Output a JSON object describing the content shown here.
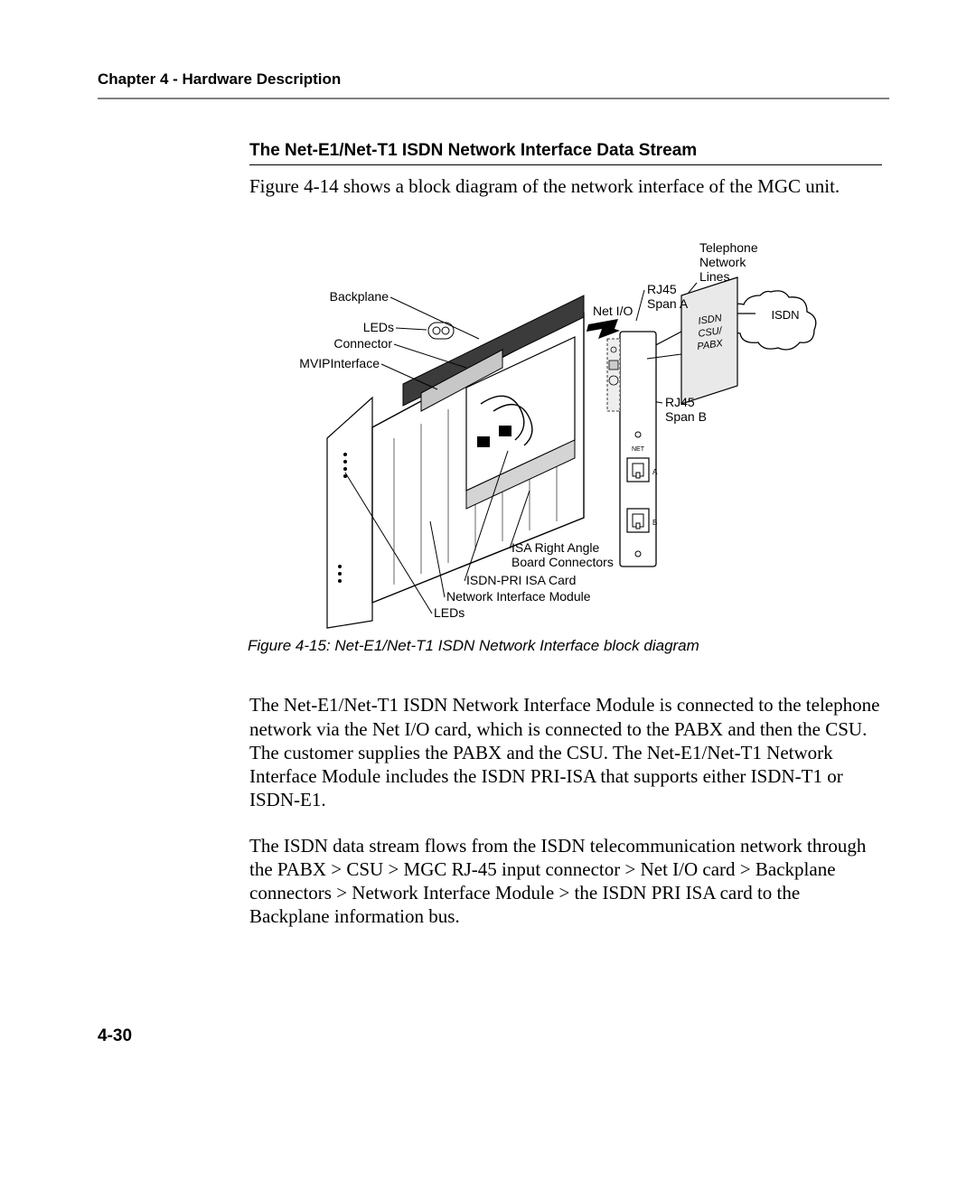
{
  "header": "Chapter 4 - Hardware Description",
  "subhead": "The Net-E1/Net-T1 ISDN Network Interface Data Stream",
  "intro": "Figure 4-14 shows a block diagram of the network interface of the MGC unit.",
  "caption": "Figure 4-15: Net-E1/Net-T1 ISDN Network Interface block diagram",
  "para1": "The Net-E1/Net-T1 ISDN Network Interface Module is connected to the telephone network via the Net I/O card, which is connected to the PABX and then the CSU. The customer supplies the PABX and the CSU. The Net-E1/Net-T1 Network Interface Module includes the ISDN PRI-ISA that supports either ISDN-T1 or ISDN-E1.",
  "para2": "The ISDN data stream flows from the ISDN telecommunication network through the PABX > CSU > MGC RJ-45 input connector > Net I/O card > Backplane connectors > Network Interface Module > the ISDN PRI ISA card to the Backplane information bus.",
  "pagenum": "4-30",
  "labels": {
    "telephone": "Telephone",
    "network": "Network",
    "lines": "Lines",
    "rj45a": "RJ45",
    "spanA": "Span A",
    "rj45b": "RJ45",
    "spanB": "Span B",
    "netio": "Net I/O",
    "isdn_cloud": "ISDN",
    "isdn_box1": "ISDN",
    "csu_box": "CSU/",
    "pabx_box": "PABX",
    "backplane": "Backplane",
    "leds_top": "LEDs",
    "connector": "Connector",
    "mvip": "MVIPInterface",
    "isa_right": "ISA Right Angle",
    "board_conn": "Board Connectors",
    "isdn_pri": "ISDN-PRI ISA Card",
    "nim": "Network Interface Module",
    "leds_bottom": "LEDs",
    "net_port": "NET"
  }
}
